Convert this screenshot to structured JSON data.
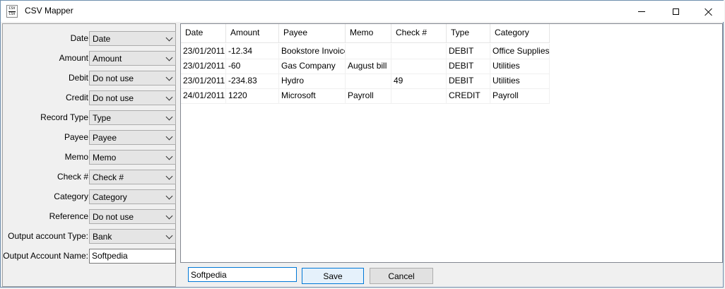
{
  "window": {
    "title": "CSV Mapper",
    "icon": "csv-app-icon",
    "icon_text_top": "CSV",
    "icon_text_bottom": "CSV"
  },
  "mapping": {
    "fields": [
      {
        "label": "Date",
        "value": "Date",
        "type": "select"
      },
      {
        "label": "Amount",
        "value": "Amount",
        "type": "select"
      },
      {
        "label": "Debit",
        "value": "Do not use",
        "type": "select"
      },
      {
        "label": "Credit",
        "value": "Do not use",
        "type": "select"
      },
      {
        "label": "Record Type",
        "value": "Type",
        "type": "select"
      },
      {
        "label": "Payee",
        "value": "Payee",
        "type": "select"
      },
      {
        "label": "Memo",
        "value": "Memo",
        "type": "select"
      },
      {
        "label": "Check #",
        "value": "Check #",
        "type": "select"
      },
      {
        "label": "Category",
        "value": "Category",
        "type": "select"
      },
      {
        "label": "Reference",
        "value": "Do not use",
        "type": "select"
      },
      {
        "label": "Output account Type:",
        "value": "Bank",
        "type": "select"
      },
      {
        "label": "Output Account Name:",
        "value": "Softpedia",
        "type": "text"
      }
    ]
  },
  "grid": {
    "columns": [
      "Date",
      "Amount",
      "Payee",
      "Memo",
      "Check #",
      "Type",
      "Category"
    ],
    "rows": [
      [
        "23/01/2011",
        "-12.34",
        "Bookstore Invoice",
        "",
        "",
        "DEBIT",
        "Office Supplies"
      ],
      [
        "23/01/2011",
        "-60",
        "Gas Company",
        "August bill",
        "",
        "DEBIT",
        "Utilities"
      ],
      [
        "23/01/2011",
        "-234.83",
        "Hydro",
        "",
        "49",
        "DEBIT",
        "Utilities"
      ],
      [
        "24/01/2011",
        "1220",
        "Microsoft",
        "Payroll",
        "",
        "CREDIT",
        "Payroll"
      ]
    ]
  },
  "footer": {
    "name_value": "Softpedia",
    "save_label": "Save",
    "cancel_label": "Cancel"
  }
}
